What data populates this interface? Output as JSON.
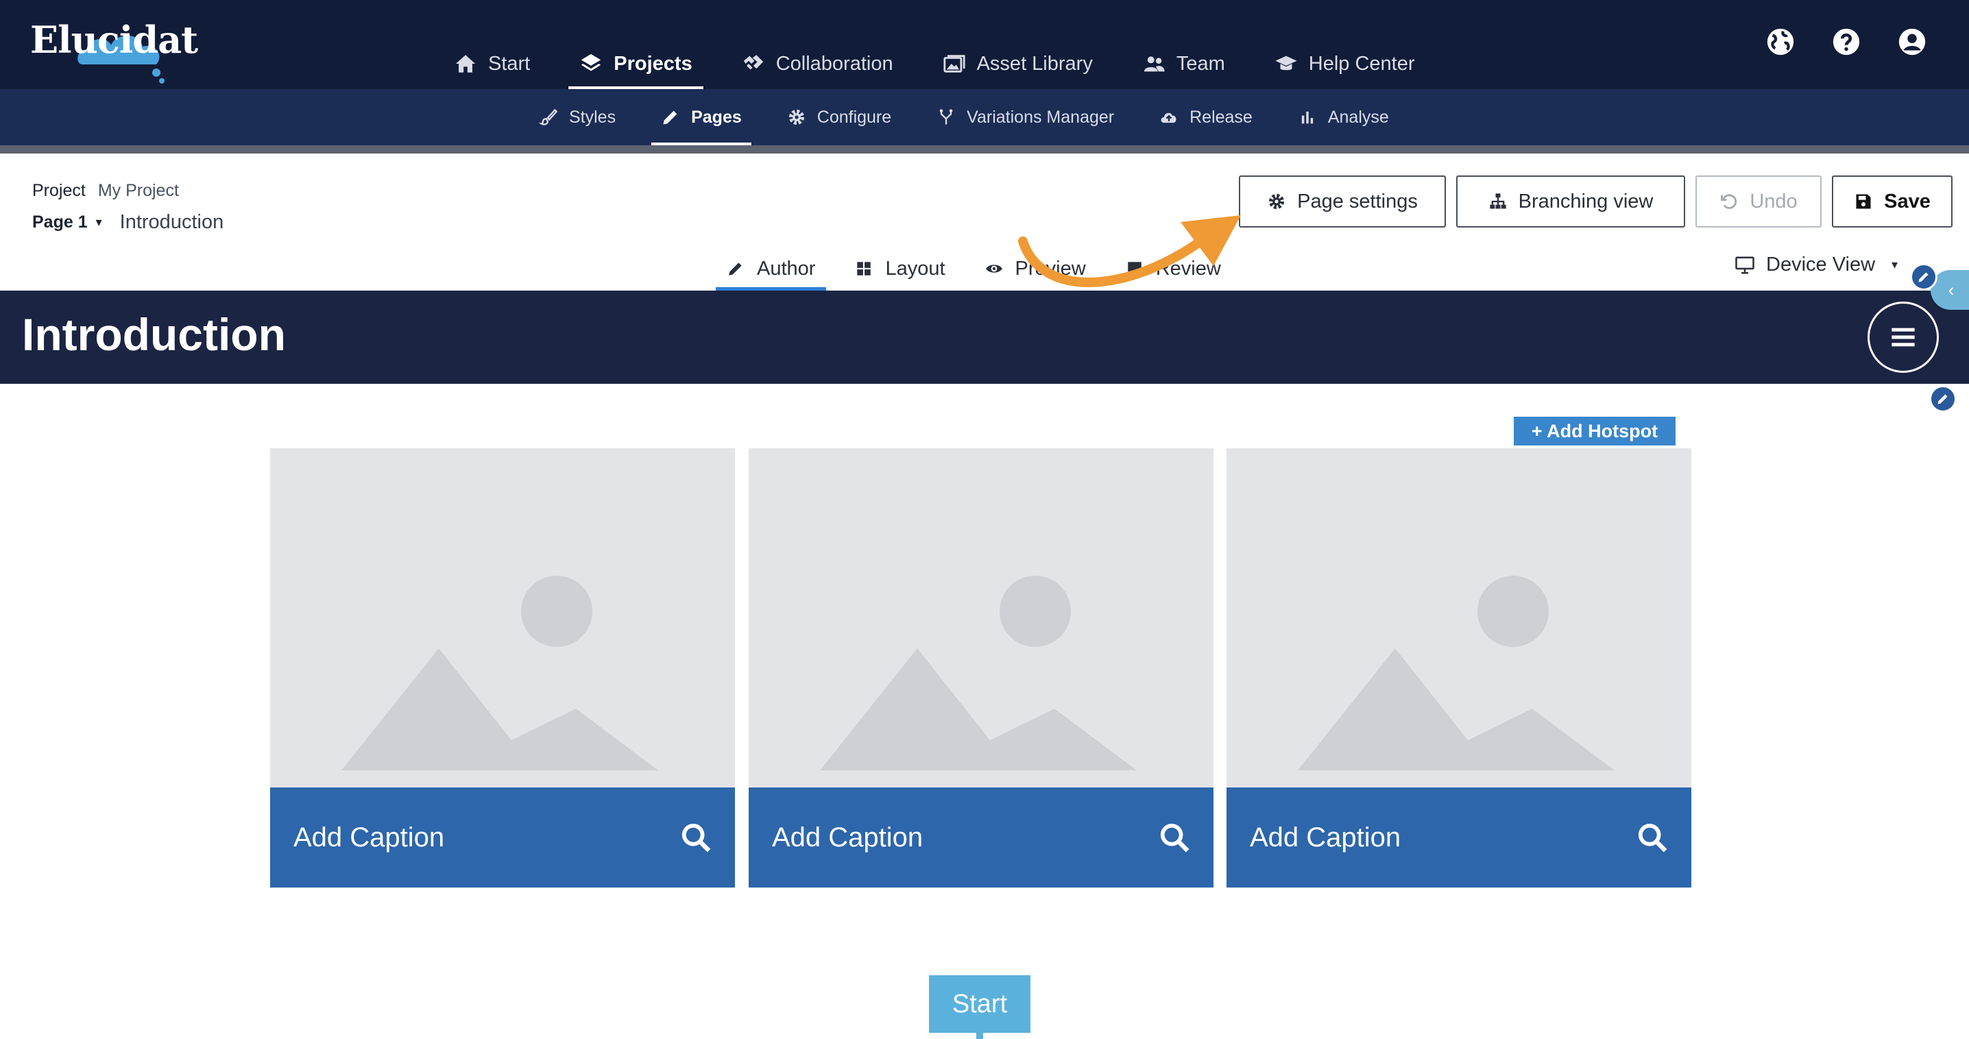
{
  "app": {
    "logo_text": "Elucidat"
  },
  "main_nav": [
    {
      "label": "Start",
      "icon": "home-icon"
    },
    {
      "label": "Projects",
      "icon": "layers-icon",
      "active": true
    },
    {
      "label": "Collaboration",
      "icon": "handshake-icon"
    },
    {
      "label": "Asset Library",
      "icon": "images-icon"
    },
    {
      "label": "Team",
      "icon": "users-icon"
    },
    {
      "label": "Help Center",
      "icon": "graduation-cap-icon"
    }
  ],
  "top_icons": [
    "globe-icon",
    "help-icon",
    "account-icon"
  ],
  "sub_nav": [
    {
      "label": "Styles",
      "icon": "brush-icon"
    },
    {
      "label": "Pages",
      "icon": "pencil-icon",
      "active": true
    },
    {
      "label": "Configure",
      "icon": "gear-icon"
    },
    {
      "label": "Variations Manager",
      "icon": "fork-icon"
    },
    {
      "label": "Release",
      "icon": "cloud-upload-icon"
    },
    {
      "label": "Analyse",
      "icon": "bar-chart-icon"
    }
  ],
  "project": {
    "label": "Project",
    "name": "My Project",
    "page_label": "Page 1",
    "page_name": "Introduction"
  },
  "toolbar": {
    "page_settings": "Page settings",
    "branching_view": "Branching view",
    "undo": "Undo",
    "save": "Save"
  },
  "mode_tabs": [
    {
      "label": "Author",
      "icon": "pencil-icon",
      "active": true
    },
    {
      "label": "Layout",
      "icon": "grid-icon"
    },
    {
      "label": "Preview",
      "icon": "eye-icon"
    },
    {
      "label": "Review",
      "icon": "comment-icon"
    }
  ],
  "device_view": {
    "label": "Device View",
    "icon": "monitor-icon"
  },
  "page": {
    "title": "Introduction",
    "add_hotspot": "+ Add Hotspot",
    "cards": [
      {
        "caption": "Add Caption"
      },
      {
        "caption": "Add Caption"
      },
      {
        "caption": "Add Caption"
      }
    ],
    "start_button": "Start"
  },
  "colors": {
    "topbar": "#111c38",
    "subbar": "#1b2d55",
    "title_bar": "#1b2442",
    "caption_bar": "#2d66ab",
    "accent_blue": "#3a86cc",
    "start_button": "#5ab2dc",
    "annotation_arrow": "#ef9a34"
  }
}
